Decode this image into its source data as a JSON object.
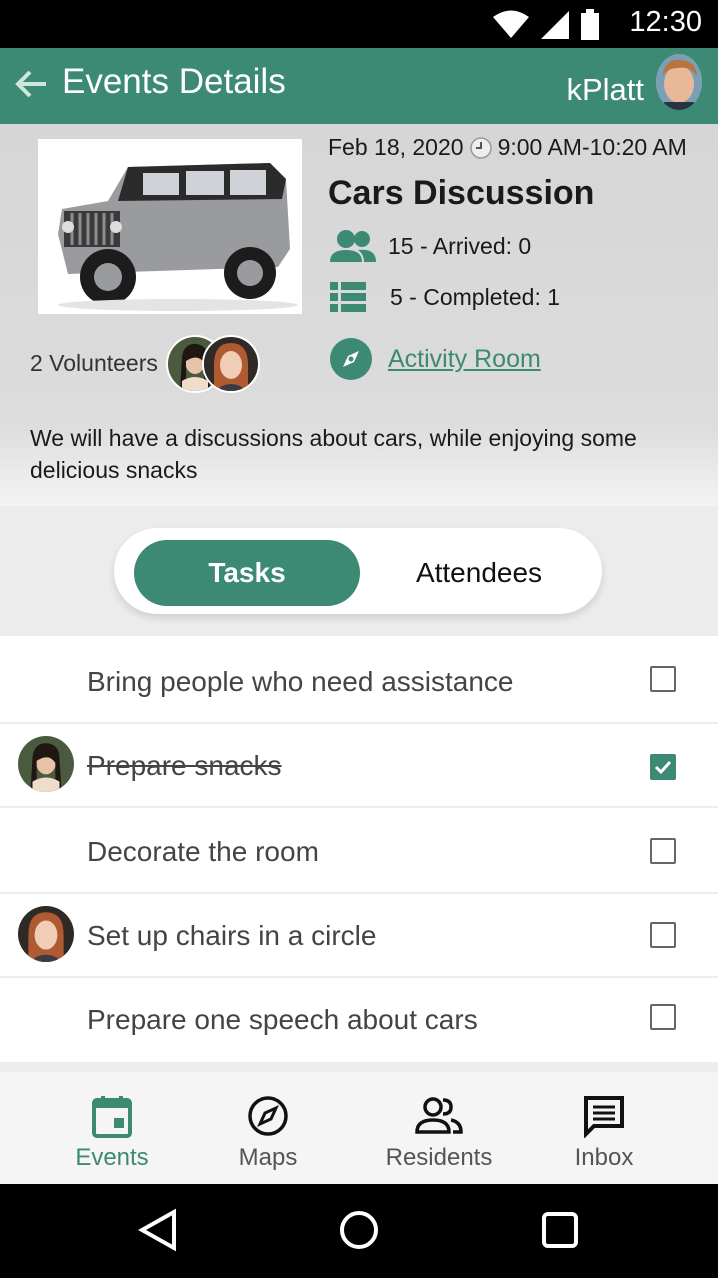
{
  "status_bar": {
    "time": "12:30"
  },
  "app_bar": {
    "title": "Events Details",
    "username": "kPlatt"
  },
  "event": {
    "date": "Feb 18, 2020",
    "time_range": "9:00 AM-10:20 AM",
    "title": "Cars Discussion",
    "attendees": "15 - Arrived: 0",
    "tasks_summary": "5 - Completed: 1",
    "location": "Activity Room",
    "volunteers": "2 Volunteers",
    "description": "We will have a discussions about cars, while enjoying some delicious snacks"
  },
  "toggle": {
    "active": "Tasks",
    "inactive": "Attendees"
  },
  "tasks": [
    {
      "label": "Bring people who need assistance",
      "done": false,
      "assignee": null
    },
    {
      "label": "Prepare snacks",
      "done": true,
      "assignee": "volunteer-1"
    },
    {
      "label": "Decorate the room",
      "done": false,
      "assignee": null
    },
    {
      "label": "Set up chairs in a circle",
      "done": false,
      "assignee": "volunteer-2"
    },
    {
      "label": "Prepare one speech about cars",
      "done": false,
      "assignee": null
    }
  ],
  "bottom_nav": [
    {
      "label": "Events",
      "icon": "calendar-icon",
      "active": true
    },
    {
      "label": "Maps",
      "icon": "compass-icon",
      "active": false
    },
    {
      "label": "Residents",
      "icon": "people-icon",
      "active": false
    },
    {
      "label": "Inbox",
      "icon": "message-icon",
      "active": false
    }
  ],
  "colors": {
    "accent": "#3c8a73",
    "status_bar": "#000000",
    "nav_bg": "#f5f5f5"
  }
}
